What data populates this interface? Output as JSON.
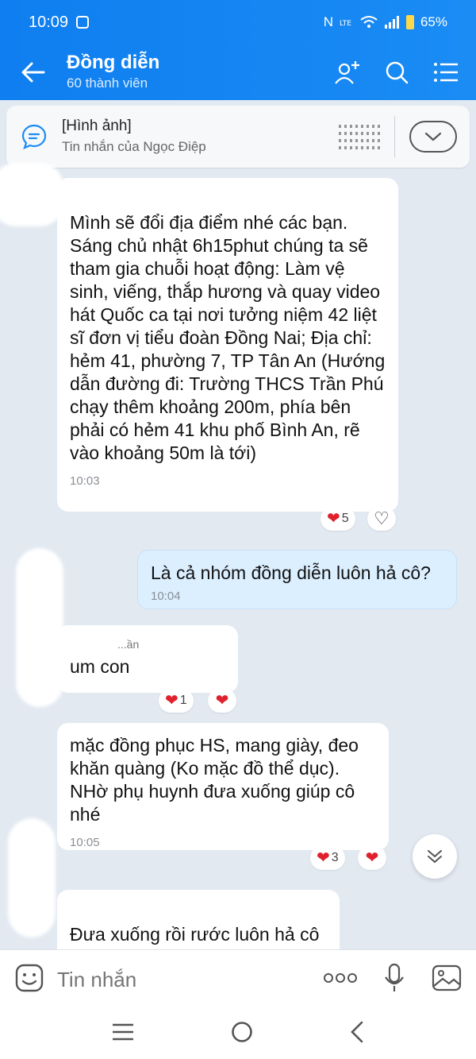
{
  "status_bar": {
    "time": "10:09",
    "battery": "65%"
  },
  "header": {
    "title": "Đồng diễn",
    "subtitle": "60 thành viên"
  },
  "pinned": {
    "title": "[Hình ảnh]",
    "subtitle": "Tin nhắn của Ngọc Điệp"
  },
  "messages": [
    {
      "text": "Mình sẽ đổi địa điểm nhé các bạn. Sáng chủ nhật 6h15phut chúng ta sẽ tham gia chuỗi hoạt động: Làm vệ sinh, viếng, thắp hương và quay video hát Quốc ca tại nơi tưởng niệm 42 liệt sĩ đơn vị tiểu đoàn Đồng Nai; Địa chỉ: hẻm 41, phường 7, TP Tân An (Hướng dẫn đường đi: Trường THCS Trần Phú chạy thêm khoảng 200m, phía bên phải có hẻm 41 khu phố Bình An, rẽ vào khoảng 50m là tới)",
      "time": "10:03",
      "reaction_count": "5"
    },
    {
      "text": "Là cả nhóm đồng diễn luôn hả cô?",
      "time": "10:04"
    },
    {
      "sender": "...ần",
      "text": "um con",
      "reaction_count": "1"
    },
    {
      "text": "mặc đồng phục HS, mang giày, đeo khăn quàng (Ko mặc đồ thể dục). NHờ phụ huynh đưa xuống giúp cô nhé",
      "time": "10:05",
      "reaction_count": "3"
    },
    {
      "text": "Đưa xuống rồi rước luôn hả cô"
    }
  ],
  "input": {
    "placeholder": "Tin nhắn"
  },
  "colors": {
    "header": "#0f7ef0",
    "heart": "#e0202c",
    "my_bubble": "#dcefff"
  }
}
